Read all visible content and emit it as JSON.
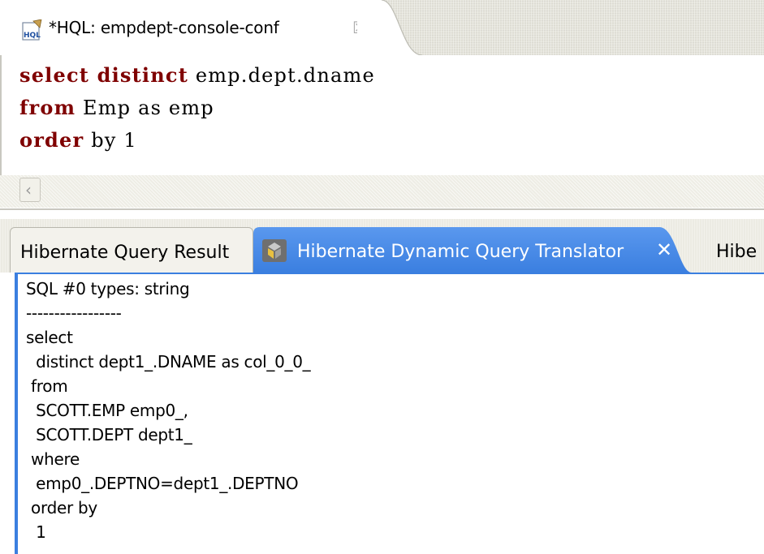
{
  "editor": {
    "tab_title": "*HQL: empdept-console-conf",
    "tab_close_glyph": "☒",
    "lines": [
      {
        "keyword": "select distinct",
        "rest": " emp.dept.dname"
      },
      {
        "keyword": "from",
        "rest": " Emp as emp"
      },
      {
        "keyword": "order",
        "rest": " by 1"
      }
    ],
    "scroll_left_glyph": "‹"
  },
  "views": {
    "tabs": [
      {
        "label": "Hibernate Query Result",
        "active": false
      },
      {
        "label": "Hibernate Dynamic Query Translator",
        "active": true,
        "close_glyph": "✕"
      },
      {
        "label": "Hibe",
        "active": false
      }
    ]
  },
  "output": {
    "lines": [
      "SQL #0 types: string",
      "-----------------",
      "select",
      "  distinct dept1_.DNAME as col_0_0_",
      " from",
      "  SCOTT.EMP emp0_,",
      "  SCOTT.DEPT dept1_",
      " where",
      "  emp0_.DEPTNO=dept1_.DEPTNO",
      " order by",
      "  1"
    ]
  },
  "colors": {
    "keyword": "#7f0000",
    "active_tab": "#3b7fe0",
    "active_tab_dark": "#1f5fc4"
  }
}
